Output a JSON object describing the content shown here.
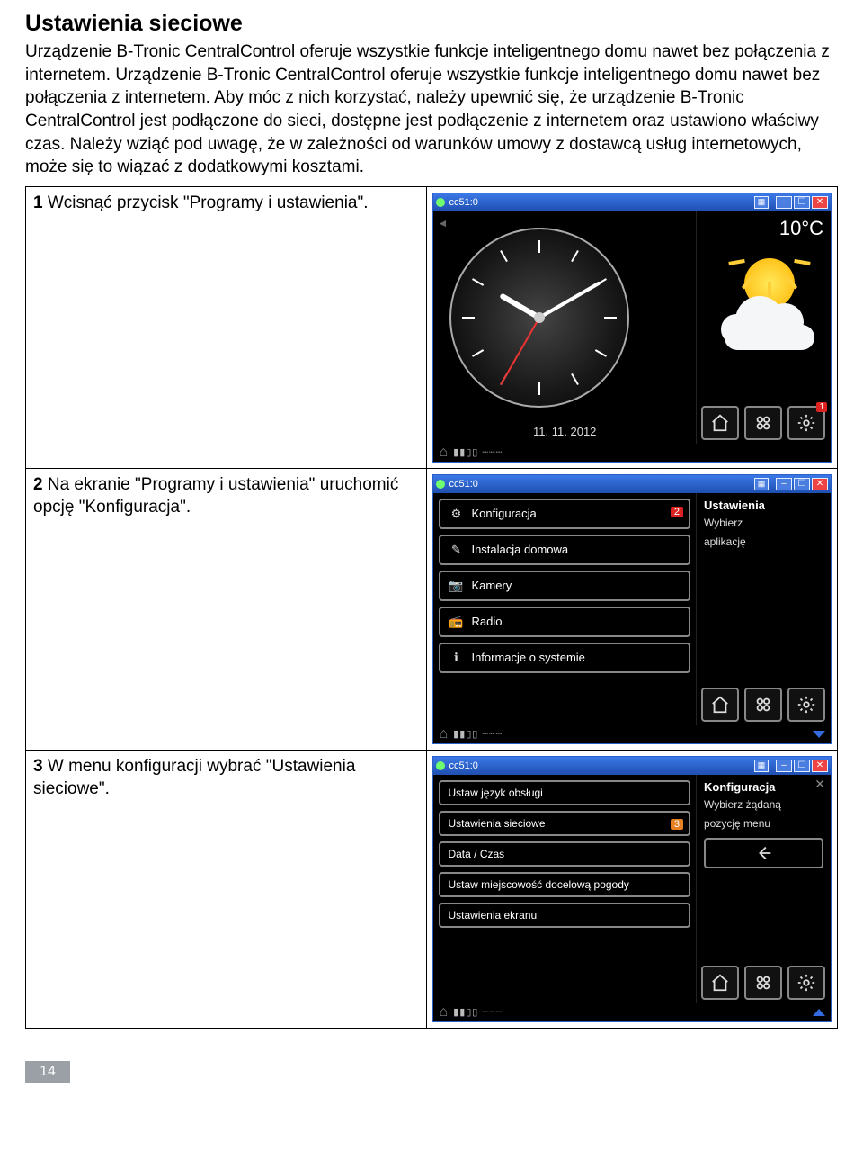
{
  "heading": "Ustawienia sieciowe",
  "intro": "Urządzenie B-Tronic CentralControl oferuje wszystkie funkcje inteligentnego domu nawet bez połączenia z internetem. Urządzenie B-Tronic CentralControl oferuje wszystkie funkcje inteligentnego domu nawet bez połączenia z internetem. Aby móc z nich korzystać, należy upewnić się, że urządzenie B-Tronic CentralControl jest podłączone do sieci, dostępne jest podłączenie z internetem oraz ustawiono właściwy czas. Należy wziąć pod uwagę, że w zależności od warunków umowy z dostawcą usług internetowych, może się to wiązać z dodatkowymi kosztami.",
  "pagenum": "14",
  "titlebar": "cc51:0",
  "steps": [
    {
      "n": "1",
      "text": "Wcisnąć przycisk \"Programy i ustawienia\"."
    },
    {
      "n": "2",
      "text": "Na ekranie \"Programy i ustawienia\" uruchomić opcję \"Konfiguracja\"."
    },
    {
      "n": "3",
      "text": "W menu konfiguracji wybrać \"Ustawienia sieciowe\"."
    }
  ],
  "screen1": {
    "temp": "10°C",
    "date": "11. 11. 2012",
    "nav_badge": "1"
  },
  "screen2": {
    "side_title": "Ustawienia",
    "side_text1": "Wybierz",
    "side_text2": "aplikację",
    "badge": "2",
    "items": [
      "Konfiguracja",
      "Instalacja domowa",
      "Kamery",
      "Radio",
      "Informacje o systemie"
    ]
  },
  "screen3": {
    "side_title": "Konfiguracja",
    "side_text1": "Wybierz żądaną",
    "side_text2": "pozycję menu",
    "badge": "3",
    "items": [
      "Ustaw język obsługi",
      "Ustawienia sieciowe",
      "Data / Czas",
      "Ustaw miejscowość docelową pogody",
      "Ustawienia ekranu"
    ]
  }
}
